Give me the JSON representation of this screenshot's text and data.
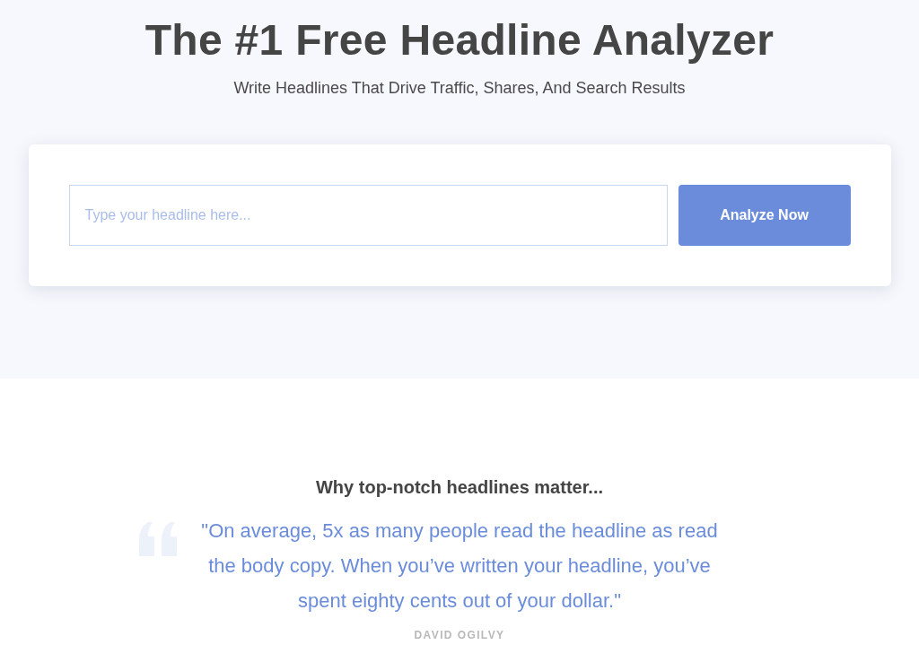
{
  "hero": {
    "title": "The #1 Free Headline Analyzer",
    "subtitle": "Write Headlines That Drive Traffic, Shares, And Search Results",
    "form": {
      "headline_field": {
        "placeholder": "Type your headline here..."
      },
      "submit_button": "Analyze Now"
    }
  },
  "quote_section": {
    "heading": "Why top-notch headlines matter...",
    "quote": "\"On average, 5x as many people read the headline as read the body copy. When you’ve written your headline, you’ve spent eighty cents out of your dollar.\"",
    "author": "DAVID OGILVY"
  }
}
